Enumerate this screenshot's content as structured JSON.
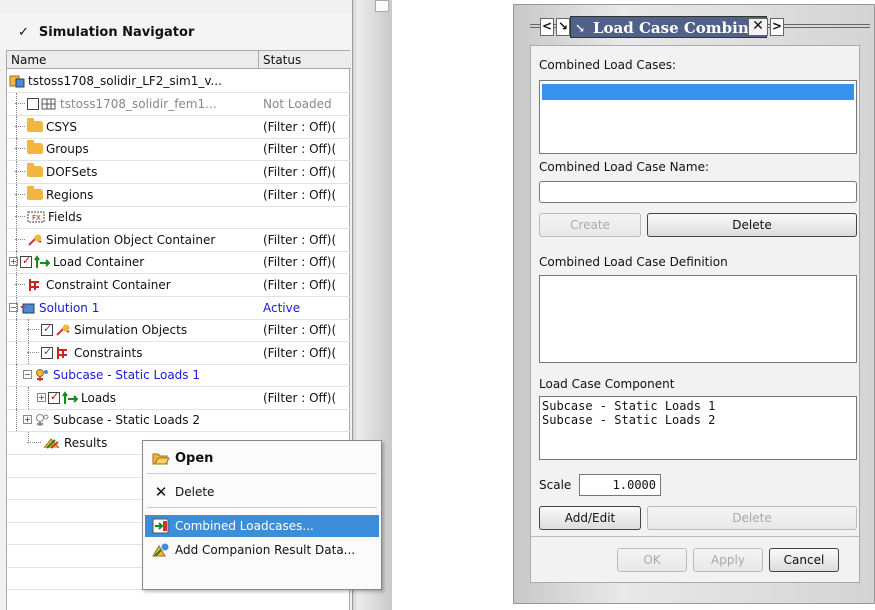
{
  "navigator": {
    "title": "Simulation Navigator",
    "columns": {
      "name": "Name",
      "status": "Status"
    },
    "rows": [
      {
        "label": "tstoss1708_solidir_LF2_sim1_v...",
        "status": ""
      },
      {
        "label": "tstoss1708_solidir_fem1...",
        "status": "Not Loaded"
      },
      {
        "label": "CSYS",
        "status": "(Filter : Off)("
      },
      {
        "label": "Groups",
        "status": "(Filter : Off)("
      },
      {
        "label": "DOFSets",
        "status": "(Filter : Off)("
      },
      {
        "label": "Regions",
        "status": "(Filter : Off)("
      },
      {
        "label": "Fields",
        "status": ""
      },
      {
        "label": "Simulation Object Container",
        "status": "(Filter : Off)("
      },
      {
        "label": "Load Container",
        "status": "(Filter : Off)("
      },
      {
        "label": "Constraint Container",
        "status": "(Filter : Off)("
      },
      {
        "label": "Solution 1",
        "status": "Active"
      },
      {
        "label": "Simulation Objects",
        "status": "(Filter : Off)("
      },
      {
        "label": "Constraints",
        "status": "(Filter : Off)("
      },
      {
        "label": "Subcase - Static Loads 1",
        "status": ""
      },
      {
        "label": "Loads",
        "status": "(Filter : Off)("
      },
      {
        "label": "Subcase - Static Loads 2",
        "status": ""
      },
      {
        "label": "Results",
        "status": ""
      }
    ]
  },
  "context_menu": {
    "open": "Open",
    "delete": "Delete",
    "combined_loadcases": "Combined Loadcases...",
    "add_companion": "Add Companion Result Data..."
  },
  "dialog": {
    "title": "Load Case Combine",
    "combined_load_cases_label": "Combined Load Cases:",
    "combined_name_label": "Combined Load Case Name:",
    "name_value": "",
    "create": "Create",
    "delete": "Delete",
    "definition_label": "Combined Load Case Definition",
    "component_label": "Load Case Component",
    "components": [
      "Subcase - Static Loads 1",
      "Subcase - Static Loads 2"
    ],
    "scale_label": "Scale",
    "scale_value": "1.0000",
    "add_edit": "Add/Edit",
    "delete2": "Delete",
    "ok": "OK",
    "apply": "Apply",
    "cancel": "Cancel"
  },
  "colors": {
    "selection": "#3c8ed8",
    "active_blue": "#1a1ad0",
    "title_bar": "#50628a"
  }
}
